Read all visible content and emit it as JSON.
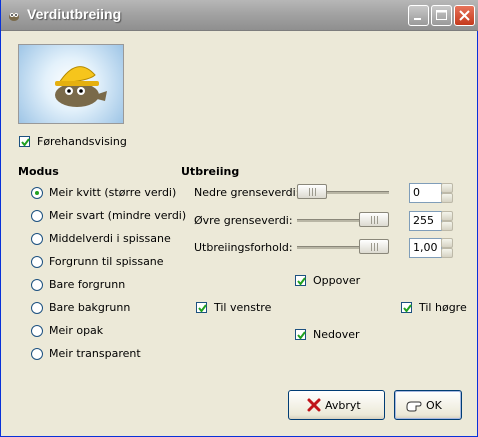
{
  "window": {
    "title": "Verdiutbreiing"
  },
  "preview_checkbox": {
    "label": "Førehandsvising",
    "checked": true
  },
  "modus": {
    "heading": "Modus",
    "options": [
      {
        "label": "Meir kvitt (større verdi)",
        "selected": true
      },
      {
        "label": "Meir svart (mindre verdi)",
        "selected": false
      },
      {
        "label": "Middelverdi i spissane",
        "selected": false
      },
      {
        "label": "Forgrunn til spissane",
        "selected": false
      },
      {
        "label": "Bare forgrunn",
        "selected": false
      },
      {
        "label": "Bare bakgrunn",
        "selected": false
      },
      {
        "label": "Meir opak",
        "selected": false
      },
      {
        "label": "Meir transparent",
        "selected": false
      }
    ]
  },
  "utbreiing": {
    "heading": "Utbreiing",
    "lower": {
      "label": "Nedre grenseverdi:",
      "value": "0",
      "fraction": 0.0
    },
    "upper": {
      "label": "Øvre grenseverdi:",
      "value": "255",
      "fraction": 1.0
    },
    "ratio": {
      "label": "Utbreiingsforhold:",
      "value": "1,00",
      "fraction": 1.0
    },
    "directions": {
      "up": {
        "label": "Oppover",
        "checked": true
      },
      "left": {
        "label": "Til venstre",
        "checked": true
      },
      "right": {
        "label": "Til høgre",
        "checked": true
      },
      "down": {
        "label": "Nedover",
        "checked": true
      }
    }
  },
  "buttons": {
    "cancel": "Avbryt",
    "ok": "OK"
  },
  "colors": {
    "accent": "#21a121",
    "titlebar": "#a3a3a3",
    "close": "#c4391c"
  },
  "icons": {
    "title": "gimp-icon",
    "cancel": "cancel-x-icon",
    "ok": "ok-hand-icon"
  }
}
